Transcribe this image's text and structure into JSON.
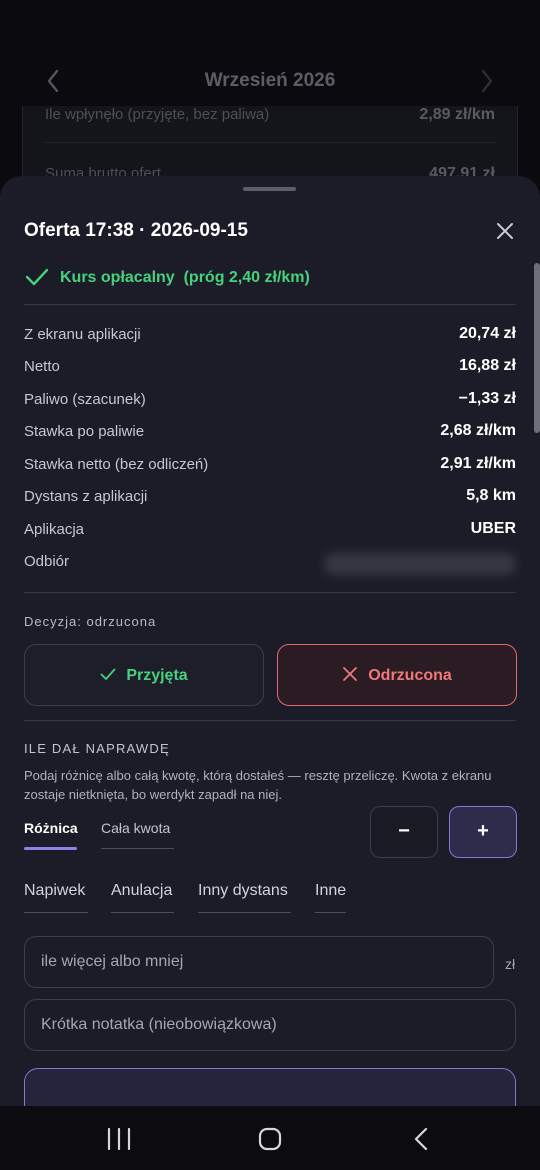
{
  "background": {
    "month_title": "Wrzesień 2026",
    "rows": [
      {
        "label": "Ile wpłynęło (przyjęte, bez paliwa)",
        "value": "2,89 zł/km"
      },
      {
        "label": "Suma brutto ofert",
        "value": "497,91 zł"
      }
    ]
  },
  "sheet": {
    "title": "Oferta 17:38 · 2026-09-15",
    "verdict": "Kurs opłacalny  (próg 2,40 zł/km)",
    "details": [
      {
        "label": "Z ekranu aplikacji",
        "value": "20,74 zł"
      },
      {
        "label": "Netto",
        "value": "16,88 zł"
      },
      {
        "label": "Paliwo (szacunek)",
        "value": "−1,33 zł"
      },
      {
        "label": "Stawka po paliwie",
        "value": "2,68 zł/km"
      },
      {
        "label": "Stawka netto (bez odliczeń)",
        "value": "2,91 zł/km"
      },
      {
        "label": "Dystans z aplikacji",
        "value": "5,8 km"
      },
      {
        "label": "Aplikacja",
        "value": "UBER"
      },
      {
        "label": "Odbiór",
        "value": ""
      }
    ],
    "decision_label": "Decyzja: odrzucona",
    "accept_label": "Przyjęta",
    "reject_label": "Odrzucona",
    "section_label": "ILE DAŁ NAPRAWDĘ",
    "hint": "Podaj różnicę albo całą kwotę, którą dostałeś — resztę przeliczę. Kwota z ekranu zostaje nietknięta, bo werdykt zapadł na niej.",
    "tabs": [
      "Różnica",
      "Cała kwota"
    ],
    "stepper": {
      "minus": "−",
      "plus": "+"
    },
    "chips": [
      "Napiwek",
      "Anulacja",
      "Inny dystans",
      "Inne"
    ],
    "amount_placeholder": "ile więcej albo mniej",
    "amount_unit": "zł",
    "note_placeholder": "Krótka notatka (nieobowiązkowa)"
  },
  "colors": {
    "accent": "#8f83e6",
    "positive": "#47d17d",
    "negative": "#f0777a",
    "sheet_bg": "#1b1c27"
  }
}
